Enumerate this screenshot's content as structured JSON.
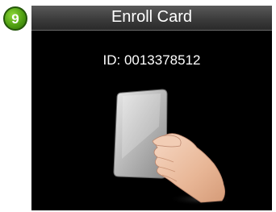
{
  "step": {
    "number": "9"
  },
  "screen": {
    "title": "Enroll Card",
    "id_line": "ID: 0013378512"
  },
  "colors": {
    "screen_bg": "#000000",
    "title_text": "#ffffff",
    "badge": "#5aa51a"
  },
  "icons": {
    "step_badge": "step-number-badge",
    "illustration": "hand-holding-card"
  }
}
